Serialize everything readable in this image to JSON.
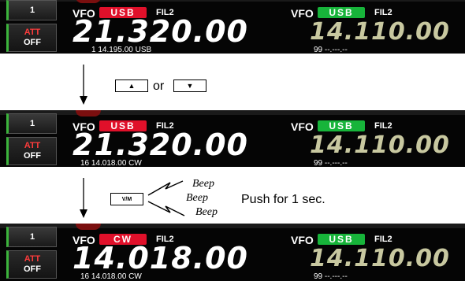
{
  "panels": [
    {
      "memory_button": "1",
      "att_line1": "ATT",
      "att_line2": "OFF",
      "main": {
        "vfo": "VFO",
        "mode": "USB",
        "mode_color": "#e0102a",
        "filter": "FIL2",
        "frequency": "21.320.00",
        "memo": "1  14.195.00 USB"
      },
      "sub": {
        "vfo": "VFO",
        "mode": "USB",
        "mode_color": "#17b43a",
        "filter": "FIL2",
        "frequency": "14.110.00",
        "memo": "99  --.---.--"
      }
    },
    {
      "memory_button": "1",
      "att_line1": "ATT",
      "att_line2": "OFF",
      "main": {
        "vfo": "VFO",
        "mode": "USB",
        "mode_color": "#e0102a",
        "filter": "FIL2",
        "frequency": "21.320.00",
        "memo": "16  14.018.00 CW"
      },
      "sub": {
        "vfo": "VFO",
        "mode": "USB",
        "mode_color": "#17b43a",
        "filter": "FIL2",
        "frequency": "14.110.00",
        "memo": "99  --.---.--"
      }
    },
    {
      "memory_button": "1",
      "att_line1": "ATT",
      "att_line2": "OFF",
      "main": {
        "vfo": "VFO",
        "mode": "CW",
        "mode_color": "#e0102a",
        "filter": "FIL2",
        "frequency": "14.018.00",
        "memo": "16  14.018.00 CW"
      },
      "sub": {
        "vfo": "VFO",
        "mode": "USB",
        "mode_color": "#17b43a",
        "filter": "FIL2",
        "frequency": "14.110.00",
        "memo": "99  --.---.--"
      }
    }
  ],
  "step1": {
    "key_up": "▲",
    "or_text": "or",
    "key_down": "▼"
  },
  "step2": {
    "key_vm": "V/M",
    "beep1": "Beep",
    "beep2": "Beep",
    "beep3": "Beep",
    "instruction": "Push for 1 sec."
  }
}
